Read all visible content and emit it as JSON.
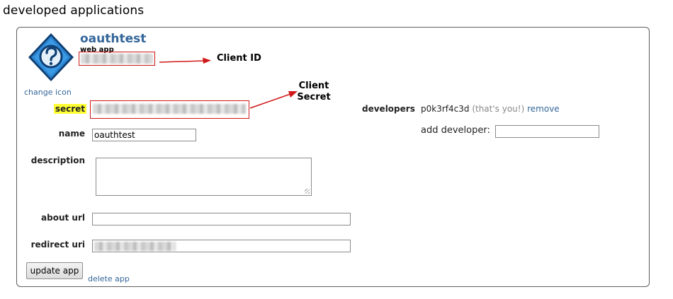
{
  "page": {
    "heading": "developed applications"
  },
  "app": {
    "name": "oauthtest",
    "type": "web app",
    "icon": "question-mark-icon",
    "change_icon_label": "change icon"
  },
  "annotations": {
    "client_id": "Client ID",
    "client_secret_line1": "Client",
    "client_secret_line2": "Secret"
  },
  "form": {
    "secret_label": "secret",
    "name_label": "name",
    "name_value": "oauthtest",
    "description_label": "description",
    "about_url_label": "about url",
    "redirect_uri_label": "redirect uri"
  },
  "developers": {
    "label": "developers",
    "user": "p0k3rf4c3d",
    "note": "(that's you!)",
    "remove_label": "remove",
    "add_label": "add developer:"
  },
  "actions": {
    "update_label": "update app",
    "delete_label": "delete app"
  },
  "colors": {
    "link": "#336699",
    "annotation_red": "#d01818",
    "highlight_yellow": "#ffff33"
  }
}
